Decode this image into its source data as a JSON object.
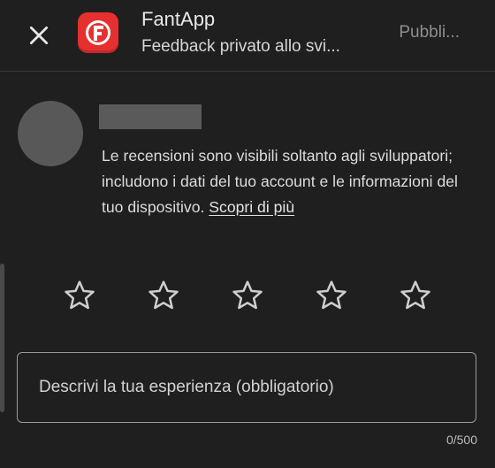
{
  "header": {
    "app_name": "FantApp",
    "subtitle": "Feedback privato allo svi...",
    "publish_label": "Pubbli..."
  },
  "notice": {
    "text": "Le recensioni sono visibili soltanto agli sviluppatori; includono i dati del tuo account e le informazioni del tuo dispositivo.",
    "link_label": "Scopri di più"
  },
  "rating": {
    "max_stars": 5,
    "selected": 0
  },
  "review": {
    "placeholder": "Descrivi la tua esperienza (obbligatorio)",
    "counter": "0/500"
  },
  "colors": {
    "background": "#1f1f1f",
    "app_icon": "#e5302f",
    "text": "#e3e3e3"
  }
}
